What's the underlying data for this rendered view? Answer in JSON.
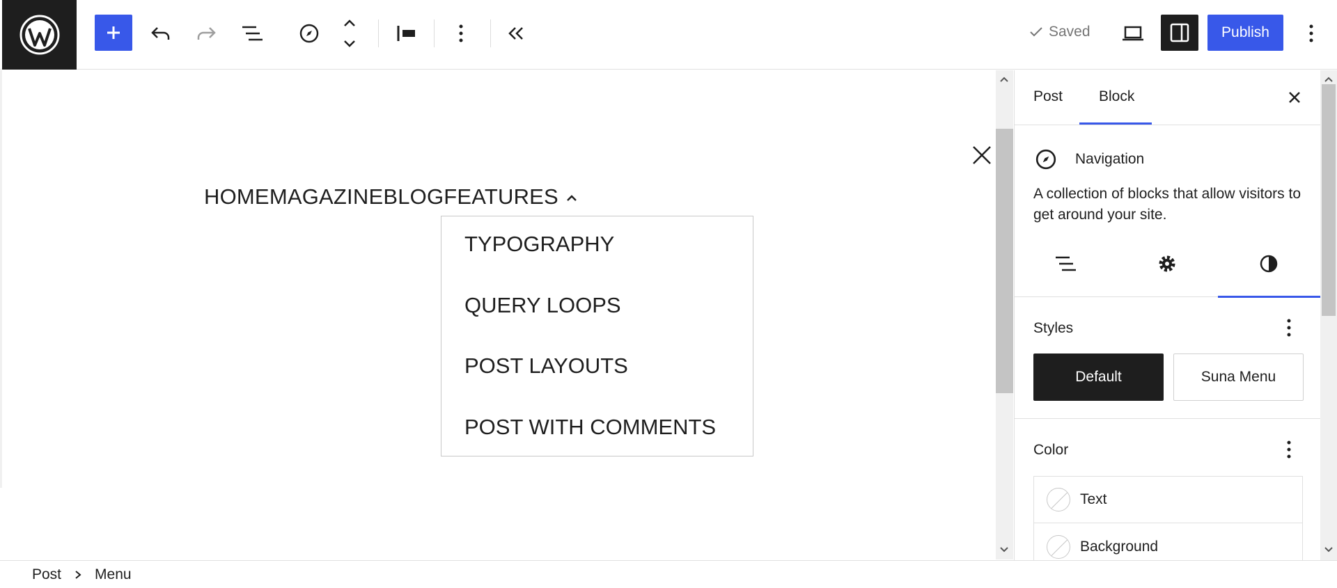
{
  "toolbar": {
    "saved_label": "Saved",
    "publish_label": "Publish"
  },
  "canvas": {
    "nav_items": [
      "HOME",
      "MAGAZINE",
      "BLOG",
      "FEATURES"
    ],
    "submenu_items": [
      "TYPOGRAPHY",
      "QUERY LOOPS",
      "POST LAYOUTS",
      "POST WITH COMMENTS"
    ]
  },
  "sidebar": {
    "tabs": [
      "Post",
      "Block"
    ],
    "active_tab": "Block",
    "block": {
      "title": "Navigation",
      "description": "A collection of blocks that allow visitors to get around your site."
    },
    "styles": {
      "title": "Styles",
      "options": [
        "Default",
        "Suna Menu"
      ],
      "selected": "Default"
    },
    "color": {
      "title": "Color",
      "items": [
        "Text",
        "Background"
      ]
    }
  },
  "breadcrumbs": [
    "Post",
    "Menu"
  ],
  "colors": {
    "accent": "#3858e9",
    "dark": "#1e1e1e"
  }
}
